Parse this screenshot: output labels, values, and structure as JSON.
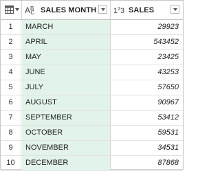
{
  "header": {
    "columns": [
      {
        "label": "SALES MONTH",
        "type_icon": "text-type-icon"
      },
      {
        "label": "SALES",
        "type_icon": "whole-number-type-icon"
      }
    ]
  },
  "rows": [
    {
      "num": "1",
      "month": "MARCH",
      "sales": "29923"
    },
    {
      "num": "2",
      "month": "APRIL",
      "sales": "543452"
    },
    {
      "num": "3",
      "month": "MAY",
      "sales": "23425"
    },
    {
      "num": "4",
      "month": "JUNE",
      "sales": "43253"
    },
    {
      "num": "5",
      "month": "JULY",
      "sales": "57650"
    },
    {
      "num": "6",
      "month": "AUGUST",
      "sales": "90967"
    },
    {
      "num": "7",
      "month": "SEPTEMBER",
      "sales": "53412"
    },
    {
      "num": "8",
      "month": "OCTOBER",
      "sales": "59531"
    },
    {
      "num": "9",
      "month": "NOVEMBER",
      "sales": "34531"
    },
    {
      "num": "10",
      "month": "DECEMBER",
      "sales": "87868"
    }
  ],
  "colors": {
    "selected_column_bg": "#e2f3ea",
    "grid_line": "#d4d4d4"
  }
}
